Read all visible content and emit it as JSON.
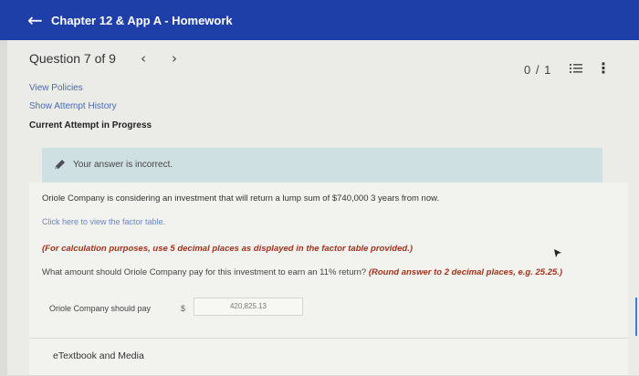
{
  "header": {
    "back_icon": "arrow-left-icon",
    "title": "Chapter 12 & App A - Homework"
  },
  "question_nav": {
    "label": "Question 7 of 9",
    "prev_icon": "chevron-left-icon",
    "next_icon": "chevron-right-icon",
    "score": "0 / 1",
    "list_icon": "list-icon",
    "more_icon": "more-vertical-icon"
  },
  "links": {
    "view_policies": "View Policies",
    "show_history": "Show Attempt History",
    "current_attempt": "Current Attempt in Progress"
  },
  "feedback": {
    "icon": "pencil-icon",
    "text": "Your answer is incorrect."
  },
  "problem": {
    "statement": "Oriole Company is considering an investment that will return a lump sum of $740,000 3 years from now.",
    "factor_link": "Click here to view the factor table.",
    "calc_note": "(For calculation purposes, use 5 decimal places as displayed in the factor table provided.)",
    "question": "What amount should Oriole Company pay for this investment to earn an 11% return?",
    "round_note": "(Round answer to 2 decimal places, e.g. 25.25.)"
  },
  "answer": {
    "label": "Oriole Company should pay",
    "currency": "$",
    "value": "420,825.13"
  },
  "etextbook": {
    "label": "eTextbook and Media"
  },
  "colors": {
    "header_bg": "#1f3fa8",
    "feedback_bg": "#cfe0e3",
    "note_red": "#a0331d",
    "link_blue": "#4a6bb0"
  }
}
